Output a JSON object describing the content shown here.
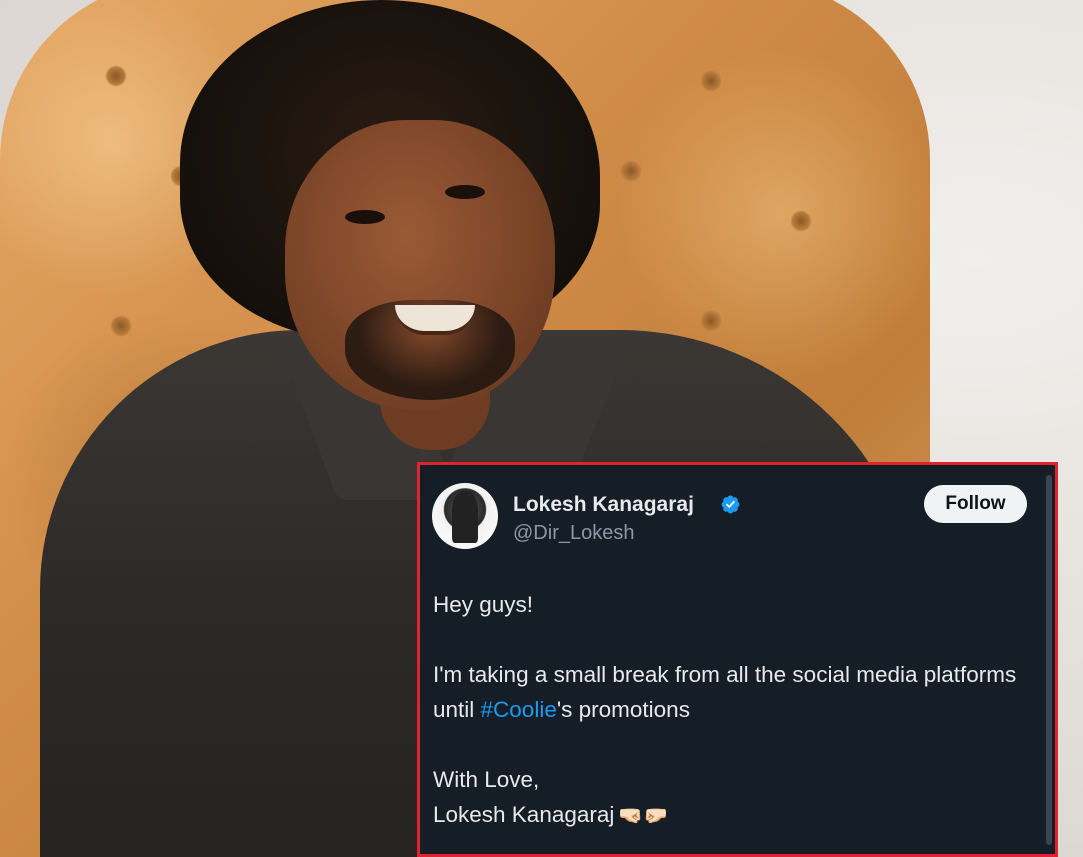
{
  "tweet": {
    "author_name": "Lokesh Kanagaraj",
    "handle": "@Dir_Lokesh",
    "verified_icon": "verified-badge-icon",
    "follow_label": "Follow",
    "greeting": "Hey guys!",
    "line_before_hashtag": "I'm taking a small break from all the social media platforms until ",
    "hashtag": "#Coolie",
    "line_after_hashtag": "'s promotions",
    "signoff": "With Love,",
    "signature": "Lokesh Kanagaraj",
    "signature_emoji": "🤜🏻🤛🏻"
  },
  "colors": {
    "card_background": "#151d27",
    "card_border": "#e0232e",
    "hashtag": "#1d9bf0",
    "verified": "#1d9bf0",
    "handle_text": "#8b98a5"
  }
}
